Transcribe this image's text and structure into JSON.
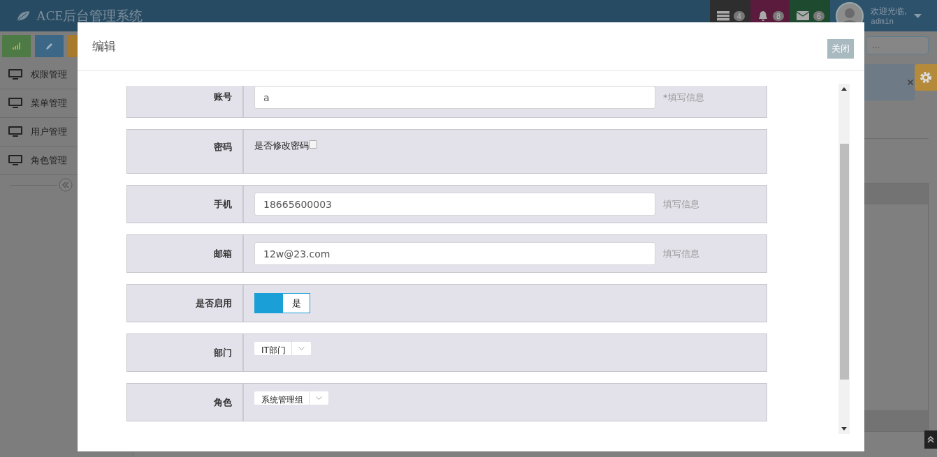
{
  "navbar": {
    "brand": "ACE后台管理系统",
    "notifications": [
      {
        "kind": "tasks",
        "count": "4",
        "color": "#2e2e2e"
      },
      {
        "kind": "bell",
        "count": "8",
        "color": "#5b1b3d"
      },
      {
        "kind": "mail",
        "count": "6",
        "color": "#1e4a2f"
      }
    ],
    "user": {
      "greeting": "欢迎光临,",
      "name": "admin"
    }
  },
  "shortcuts": [
    {
      "kind": "chart",
      "color": "#4d7a45"
    },
    {
      "kind": "pencil",
      "color": "#3d6787"
    },
    {
      "kind": "other",
      "color": "#a87a2c"
    }
  ],
  "sidebar": {
    "items": [
      {
        "label": "权限管理"
      },
      {
        "label": "菜单管理"
      },
      {
        "label": "用户管理"
      },
      {
        "label": "角色管理"
      }
    ]
  },
  "search": {
    "placeholder": "..."
  },
  "modal": {
    "title": "编辑",
    "close": "关闭",
    "fields": [
      {
        "kind": "text",
        "label": "账号",
        "value": "a",
        "hint": "*填写信息"
      },
      {
        "kind": "checkbox",
        "label": "密码",
        "text": "是否修改密码",
        "checked": false
      },
      {
        "kind": "text",
        "label": "手机",
        "value": "18665600003",
        "hint": "填写信息"
      },
      {
        "kind": "text",
        "label": "邮箱",
        "value": "12w@23.com",
        "hint": "填写信息"
      },
      {
        "kind": "switch",
        "label": "是否启用",
        "text": "是",
        "on": true
      },
      {
        "kind": "select",
        "label": "部门",
        "value": "IT部门"
      },
      {
        "kind": "select",
        "label": "角色",
        "value": "系统管理组"
      }
    ]
  }
}
